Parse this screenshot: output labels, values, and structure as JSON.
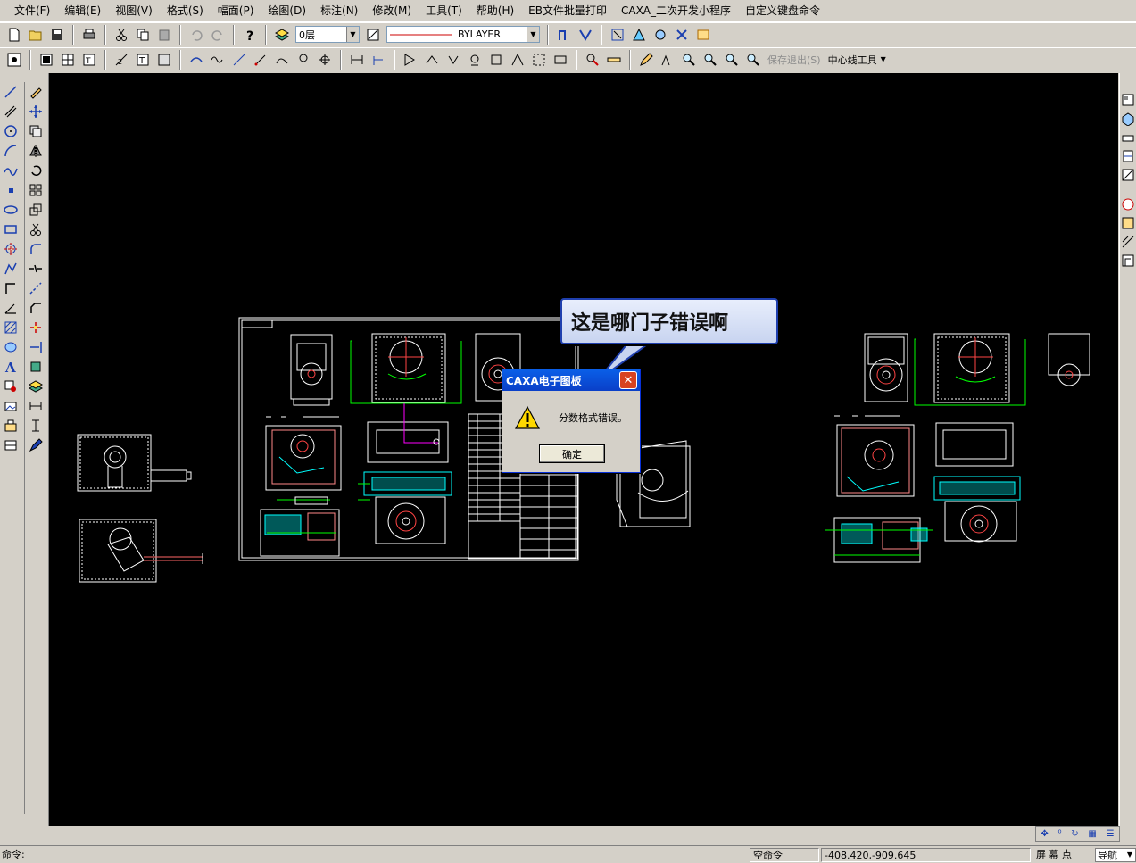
{
  "menu": {
    "items": [
      "文件(F)",
      "编辑(E)",
      "视图(V)",
      "格式(S)",
      "幅面(P)",
      "绘图(D)",
      "标注(N)",
      "修改(M)",
      "工具(T)",
      "帮助(H)",
      "EB文件批量打印",
      "CAXA_二次开发小程序",
      "自定义键盘命令"
    ]
  },
  "toolbar": {
    "layer_value": "0层",
    "linetype_value": "BYLAYER",
    "save_exit_label": "保存退出(S)",
    "centerline_tool_label": "中心线工具"
  },
  "callout": {
    "text": "这是哪门子错误啊"
  },
  "dialog": {
    "title": "CAXA电子图板",
    "message": "分数格式错误。",
    "ok_label": "确定",
    "close_glyph": "✕"
  },
  "status": {
    "command_label": "命令:",
    "state": "空命令",
    "coordinates": "-408.420,-909.645",
    "snap_mode": "屏 幕 点",
    "nav_mode": "导航"
  },
  "colors": {
    "canvas_bg": "#000000",
    "drawing_lines": "#ffffff",
    "dim_lines": "#00ff00",
    "highlight": "#00ffff",
    "center_marks": "#ff0000",
    "dialog_title": "#0a50dc",
    "close_button": "#d8431f"
  }
}
